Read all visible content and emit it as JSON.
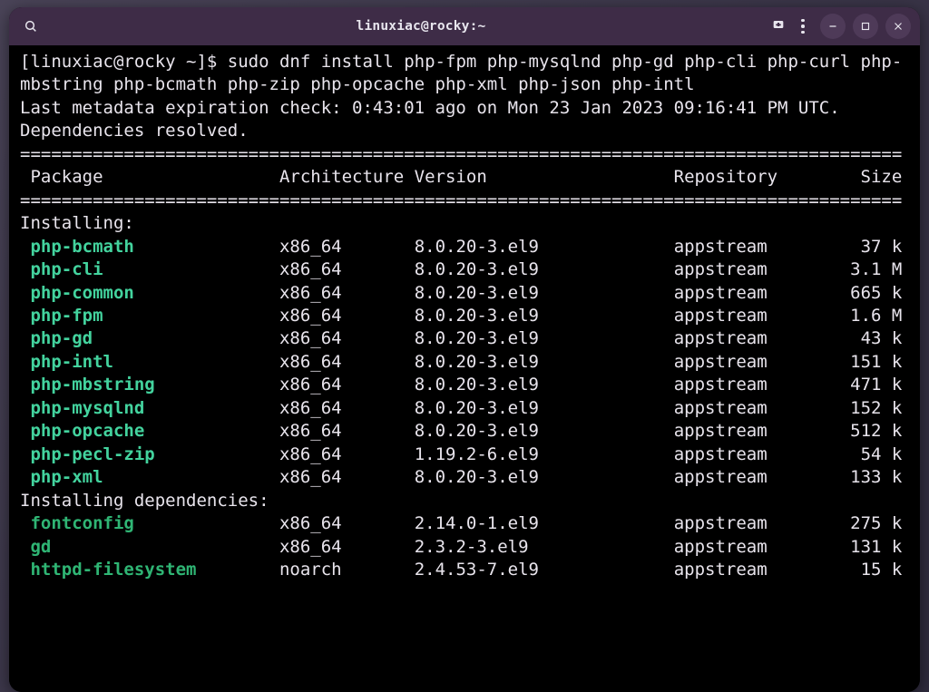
{
  "window": {
    "title": "linuxiac@rocky:~"
  },
  "prompt": "[linuxiac@rocky ~]$ ",
  "command": "sudo dnf install php-fpm php-mysqlnd php-gd php-cli php-curl php-mbstring php-bcmath php-zip php-opcache php-xml php-json php-intl",
  "meta_line": "Last metadata expiration check: 0:43:01 ago on Mon 23 Jan 2023 09:16:41 PM UTC.",
  "deps_resolved": "Dependencies resolved.",
  "headers": {
    "package": " Package",
    "arch": "Architecture",
    "version": "Version",
    "repo": "Repository",
    "size": "Size"
  },
  "installing_label": "Installing:",
  "installing_deps_label": "Installing dependencies:",
  "packages": [
    {
      "name": "php-bcmath",
      "arch": "x86_64",
      "version": "8.0.20-3.el9",
      "repo": "appstream",
      "size": "37 k"
    },
    {
      "name": "php-cli",
      "arch": "x86_64",
      "version": "8.0.20-3.el9",
      "repo": "appstream",
      "size": "3.1 M"
    },
    {
      "name": "php-common",
      "arch": "x86_64",
      "version": "8.0.20-3.el9",
      "repo": "appstream",
      "size": "665 k"
    },
    {
      "name": "php-fpm",
      "arch": "x86_64",
      "version": "8.0.20-3.el9",
      "repo": "appstream",
      "size": "1.6 M"
    },
    {
      "name": "php-gd",
      "arch": "x86_64",
      "version": "8.0.20-3.el9",
      "repo": "appstream",
      "size": "43 k"
    },
    {
      "name": "php-intl",
      "arch": "x86_64",
      "version": "8.0.20-3.el9",
      "repo": "appstream",
      "size": "151 k"
    },
    {
      "name": "php-mbstring",
      "arch": "x86_64",
      "version": "8.0.20-3.el9",
      "repo": "appstream",
      "size": "471 k"
    },
    {
      "name": "php-mysqlnd",
      "arch": "x86_64",
      "version": "8.0.20-3.el9",
      "repo": "appstream",
      "size": "152 k"
    },
    {
      "name": "php-opcache",
      "arch": "x86_64",
      "version": "8.0.20-3.el9",
      "repo": "appstream",
      "size": "512 k"
    },
    {
      "name": "php-pecl-zip",
      "arch": "x86_64",
      "version": "1.19.2-6.el9",
      "repo": "appstream",
      "size": "54 k"
    },
    {
      "name": "php-xml",
      "arch": "x86_64",
      "version": "8.0.20-3.el9",
      "repo": "appstream",
      "size": "133 k"
    }
  ],
  "dep_packages": [
    {
      "name": "fontconfig",
      "arch": "x86_64",
      "version": "2.14.0-1.el9",
      "repo": "appstream",
      "size": "275 k"
    },
    {
      "name": "gd",
      "arch": "x86_64",
      "version": "2.3.2-3.el9",
      "repo": "appstream",
      "size": "131 k"
    },
    {
      "name": "httpd-filesystem",
      "arch": "noarch",
      "version": "2.4.53-7.el9",
      "repo": "appstream",
      "size": "15 k"
    }
  ]
}
